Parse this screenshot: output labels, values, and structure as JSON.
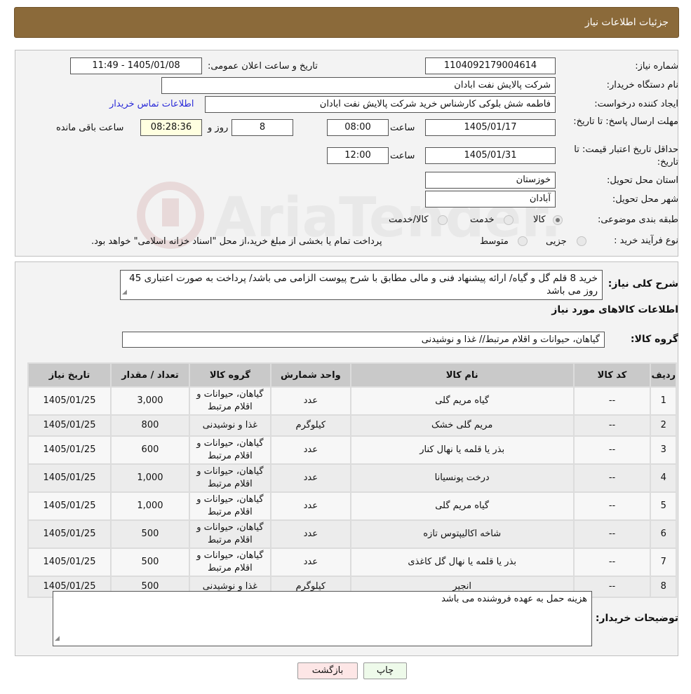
{
  "page_title": "جزئیات اطلاعات نیاز",
  "fields": {
    "need_number_label": "شماره نیاز:",
    "need_number": "1104092179004614",
    "announce_label": "تاریخ و ساعت اعلان عمومی:",
    "announce_value": "1405/01/08 - 11:49",
    "buyer_org_label": "نام دستگاه خریدار:",
    "buyer_org": "شرکت پالایش نفت ابادان",
    "creator_label": "ایجاد کننده درخواست:",
    "creator": "فاطمه شش بلوکی کارشناس خرید شرکت پالایش نفت ابادان",
    "contact_link": "اطلاعات تماس خریدار",
    "reply_deadline_label": "مهلت ارسال پاسخ: تا تاریخ:",
    "reply_date": "1405/01/17",
    "time_label": "ساعت",
    "reply_time": "08:00",
    "days": "8",
    "days_label": "روز و",
    "remaining_time": "08:28:36",
    "remaining_label": "ساعت باقی مانده",
    "validity_label": "حداقل تاریخ اعتبار قیمت: تا تاریخ:",
    "validity_date": "1405/01/31",
    "validity_time": "12:00",
    "province_label": "استان محل تحویل:",
    "province": "خوزستان",
    "city_label": "شهر محل تحویل:",
    "city": "آبادان",
    "category_label": "طبقه بندی موضوعی:",
    "category_options": [
      "کالا",
      "خدمت",
      "کالا/خدمت"
    ],
    "category_selected": "کالا",
    "process_label": "نوع فرآیند خرید :",
    "process_options": [
      "جزیی",
      "متوسط"
    ],
    "process_note": "پرداخت تمام یا بخشی از مبلغ خرید،از محل \"اسناد خزانه اسلامی\" خواهد بود."
  },
  "description": {
    "label": "شرح کلی نیاز:",
    "text": "خرید 8 قلم گل و گیاه/ ارائه پیشنهاد فنی و مالی مطابق با شرح پیوست الزامی می باشد/ پرداخت به صورت اعتباری 45 روز می باشد"
  },
  "goods_info_title": "اطلاعات کالاهای مورد نیاز",
  "goods_group": {
    "label": "گروه کالا:",
    "value": "گیاهان، حیوانات و اقلام مرتبط// غذا و نوشیدنی"
  },
  "table": {
    "headers": [
      "ردیف",
      "کد کالا",
      "نام کالا",
      "واحد شمارش",
      "گروه کالا",
      "تعداد / مقدار",
      "تاریخ نیاز"
    ],
    "rows": [
      {
        "row": "1",
        "code": "--",
        "name": "گیاه مریم گلی",
        "unit": "عدد",
        "group": "گیاهان، حیوانات و اقلام مرتبط",
        "qty": "3,000",
        "date": "1405/01/25"
      },
      {
        "row": "2",
        "code": "--",
        "name": "مریم گلی خشک",
        "unit": "کیلوگرم",
        "group": "غذا و نوشیدنی",
        "qty": "800",
        "date": "1405/01/25"
      },
      {
        "row": "3",
        "code": "--",
        "name": "بذر یا قلمه یا نهال کنار",
        "unit": "عدد",
        "group": "گیاهان، حیوانات و اقلام مرتبط",
        "qty": "600",
        "date": "1405/01/25"
      },
      {
        "row": "4",
        "code": "--",
        "name": "درخت پونسیانا",
        "unit": "عدد",
        "group": "گیاهان، حیوانات و اقلام مرتبط",
        "qty": "1,000",
        "date": "1405/01/25"
      },
      {
        "row": "5",
        "code": "--",
        "name": "گیاه مریم گلی",
        "unit": "عدد",
        "group": "گیاهان، حیوانات و اقلام مرتبط",
        "qty": "1,000",
        "date": "1405/01/25"
      },
      {
        "row": "6",
        "code": "--",
        "name": "شاخه اکالیپتوس تازه",
        "unit": "عدد",
        "group": "گیاهان، حیوانات و اقلام مرتبط",
        "qty": "500",
        "date": "1405/01/25"
      },
      {
        "row": "7",
        "code": "--",
        "name": "بذر یا قلمه یا نهال گل کاغذی",
        "unit": "عدد",
        "group": "گیاهان، حیوانات و اقلام مرتبط",
        "qty": "500",
        "date": "1405/01/25"
      },
      {
        "row": "8",
        "code": "--",
        "name": "انجیر",
        "unit": "کیلوگرم",
        "group": "غذا و نوشیدنی",
        "qty": "500",
        "date": "1405/01/25"
      }
    ]
  },
  "buyer_notes": {
    "label": "توضیحات خریدار:",
    "text": "هزینه حمل به عهده فروشنده می باشد"
  },
  "buttons": {
    "print": "چاپ",
    "back": "بازگشت"
  },
  "watermark_text": "AriaTender.neT"
}
